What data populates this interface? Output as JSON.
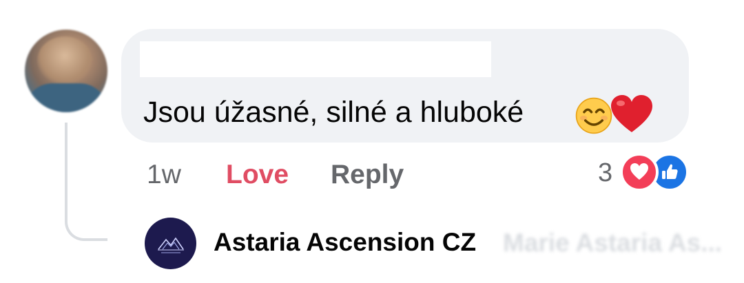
{
  "comment": {
    "text": "Jsou úžasné, silné a hluboké",
    "emoji": [
      "smiling-face-icon",
      "red-heart-icon"
    ],
    "time": "1w",
    "love_label": "Love",
    "reply_label": "Reply",
    "reaction_count": "3",
    "reactions": [
      "love-reaction-icon",
      "like-reaction-icon"
    ]
  },
  "reply": {
    "author": "Astaria Ascension CZ",
    "preview": "Marie Astaria As..."
  },
  "colors": {
    "bubble": "#f0f2f5",
    "love": "#e04d63",
    "muted": "#65676b",
    "like_blue": "#1b74e4",
    "love_red": "#f33e58"
  }
}
